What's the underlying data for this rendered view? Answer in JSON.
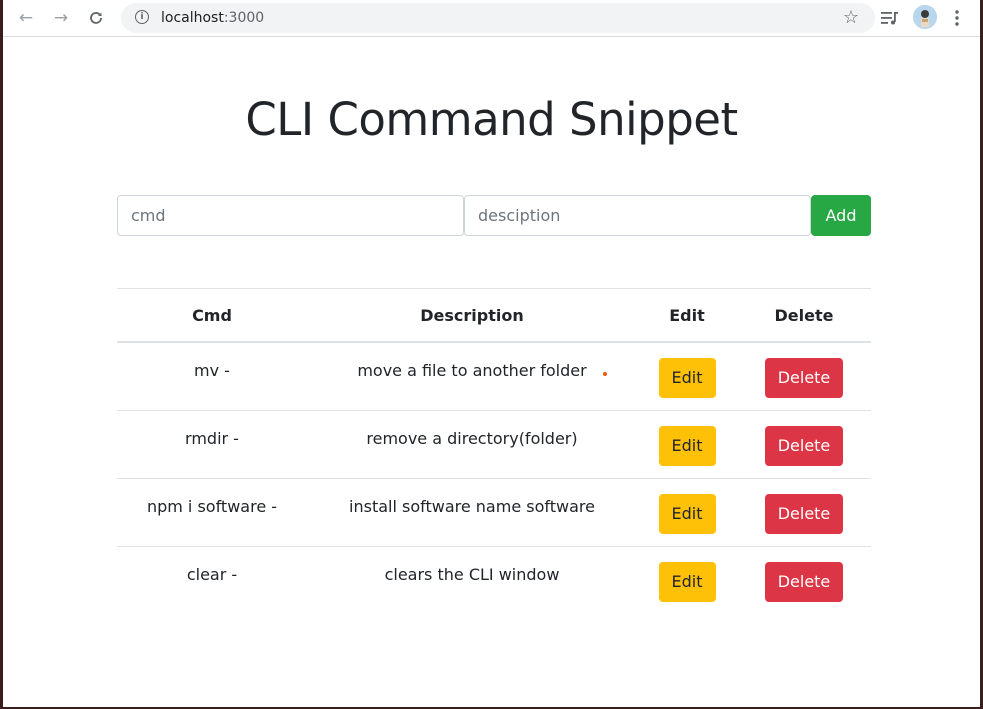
{
  "browser": {
    "url_host": "localhost",
    "url_port": ":3000",
    "icons": {
      "back": "arrow-left-icon",
      "forward": "arrow-right-icon",
      "reload": "reload-icon",
      "info": "info-icon",
      "bookmark": "star-icon",
      "media": "media-queue-icon",
      "profile": "avatar",
      "menu": "kebab-menu-icon"
    }
  },
  "page": {
    "title": "CLI Command Snippet",
    "form": {
      "cmd_placeholder": "cmd",
      "cmd_value": "",
      "desc_placeholder": "desciption",
      "desc_value": "",
      "add_label": "Add"
    },
    "table": {
      "headers": {
        "cmd": "Cmd",
        "description": "Description",
        "edit": "Edit",
        "delete": "Delete"
      },
      "rows": [
        {
          "cmd": "mv -",
          "description": "move a file to another folder",
          "edit_label": "Edit",
          "delete_label": "Delete"
        },
        {
          "cmd": "rmdir -",
          "description": "remove a directory(folder)",
          "edit_label": "Edit",
          "delete_label": "Delete"
        },
        {
          "cmd": "npm i software -",
          "description": "install software name software",
          "edit_label": "Edit",
          "delete_label": "Delete"
        },
        {
          "cmd": "clear -",
          "description": "clears the CLI window",
          "edit_label": "Edit",
          "delete_label": "Delete"
        }
      ]
    }
  },
  "colors": {
    "add": "#28a745",
    "edit": "#ffc107",
    "delete": "#dc3545",
    "text": "#212529"
  }
}
